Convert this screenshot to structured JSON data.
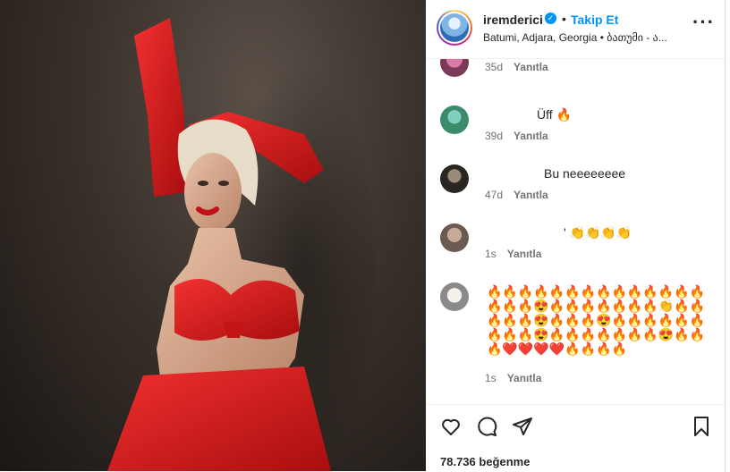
{
  "header": {
    "username": "iremderici",
    "dot": "•",
    "follow_label": "Takip Et",
    "location": "Batumi, Adjara, Georgia • ბათუმი - ა..."
  },
  "comments": [
    {
      "text": "",
      "age": "35d",
      "reply_label": "Yanıtla"
    },
    {
      "text": "Üff 🔥",
      "age": "39d",
      "reply_label": "Yanıtla"
    },
    {
      "text": "Bu neeeeeeee",
      "age": "47d",
      "reply_label": "Yanıtla"
    },
    {
      "text": "' 👏👏👏👏",
      "age": "1s",
      "reply_label": "Yanıtla"
    },
    {
      "text": "🔥🔥🔥🔥🔥🔥🔥🔥🔥🔥🔥🔥🔥🔥🔥🔥🔥😍🔥🔥🔥🔥🔥🔥🔥👏🔥🔥🔥🔥🔥😍🔥🔥🔥😍🔥🔥🔥🔥🔥🔥🔥🔥🔥😍🔥🔥🔥🔥🔥🔥🔥😍🔥🔥🔥❤️❤️❤️❤️🔥🔥🔥🔥",
      "age": "1s",
      "reply_label": "Yanıtla"
    }
  ],
  "likes_label": "78.736 beğenme",
  "icons": {
    "verified": "verified-badge-icon",
    "more": "more-options-icon",
    "like": "heart-icon",
    "comment": "comment-icon",
    "share": "share-icon",
    "save": "bookmark-icon"
  },
  "colors": {
    "accent": "#0095f6",
    "photo_red": "#d91a1a"
  }
}
